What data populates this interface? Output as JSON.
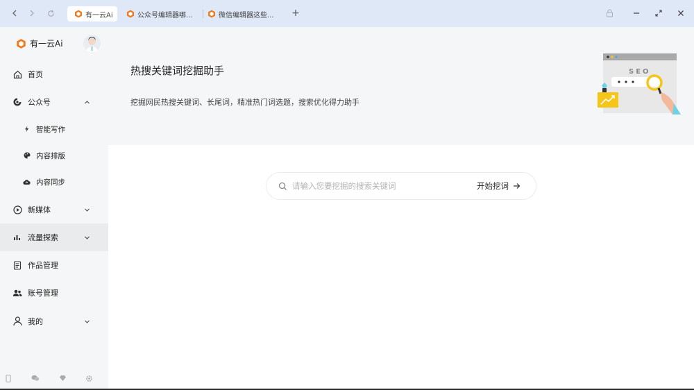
{
  "tabs": [
    {
      "title": "有一云Ai",
      "active": true
    },
    {
      "title": "公众号编辑器哪...",
      "active": false
    },
    {
      "title": "微信编辑器这些...",
      "active": false
    }
  ],
  "brand": {
    "name": "有一云Ai",
    "color": "#f07b1e"
  },
  "sidebar": {
    "items": [
      {
        "label": "首页",
        "icon": "home-icon"
      },
      {
        "label": "公众号",
        "icon": "wechat-official-icon",
        "expanded": true
      },
      {
        "label": "智能写作",
        "icon": "lightning-icon"
      },
      {
        "label": "内容排版",
        "icon": "palette-icon"
      },
      {
        "label": "内容同步",
        "icon": "cloud-sync-icon"
      },
      {
        "label": "新媒体",
        "icon": "play-circle-icon"
      },
      {
        "label": "流量探索",
        "icon": "bar-chart-icon",
        "active": true
      },
      {
        "label": "作品管理",
        "icon": "document-icon"
      },
      {
        "label": "账号管理",
        "icon": "users-icon"
      },
      {
        "label": "我的",
        "icon": "user-icon"
      }
    ]
  },
  "hero": {
    "title": "热搜关键词挖掘助手",
    "description": "挖掘网民热搜关键词、长尾词，精准热门词选题，搜索优化得力助手",
    "illustration_text": "SEO"
  },
  "search": {
    "placeholder": "请输入您要挖掘的搜索关键词",
    "value": "",
    "button_label": "开始挖词"
  },
  "colors": {
    "accent": "#f07b1e",
    "titlebar": "#dfe8f7",
    "sidebar": "#f5f6f7"
  }
}
